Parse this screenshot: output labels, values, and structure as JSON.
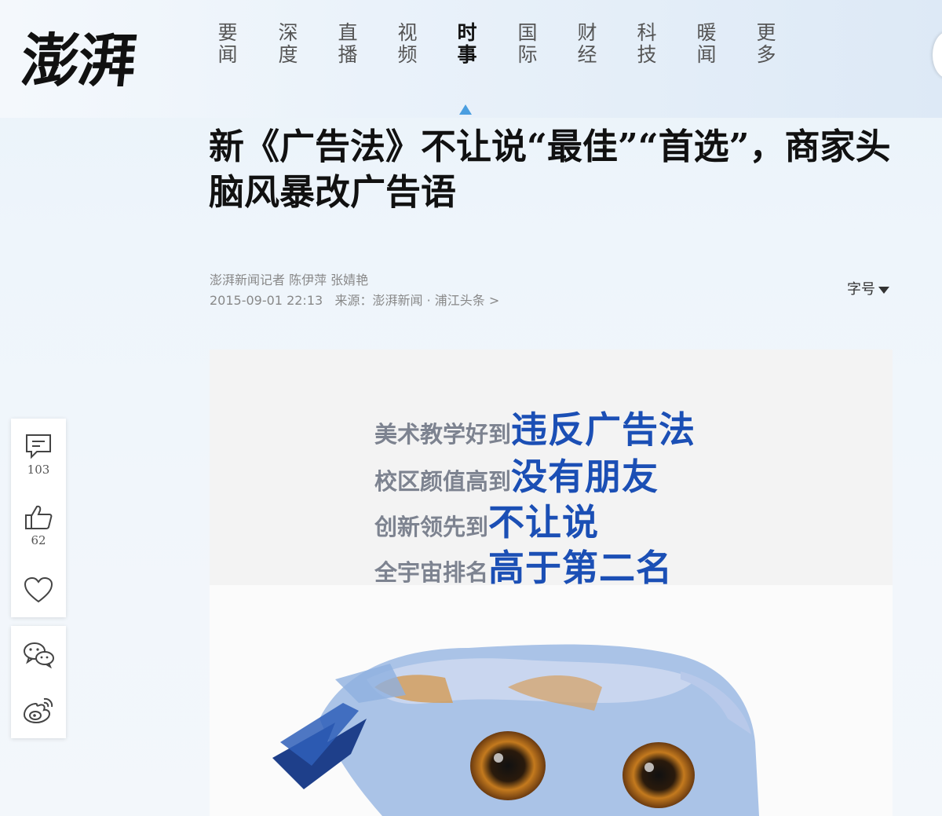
{
  "brand": {
    "logo_text": "澎湃"
  },
  "nav": {
    "items": [
      {
        "label": "要闻",
        "active": false
      },
      {
        "label": "深度",
        "active": false
      },
      {
        "label": "直播",
        "active": false
      },
      {
        "label": "视频",
        "active": false
      },
      {
        "label": "时事",
        "active": true
      },
      {
        "label": "国际",
        "active": false
      },
      {
        "label": "财经",
        "active": false
      },
      {
        "label": "科技",
        "active": false
      },
      {
        "label": "暖闻",
        "active": false
      },
      {
        "label": "更多",
        "active": false
      }
    ]
  },
  "article": {
    "title": "新《广告法》不让说“最佳”“首选”，商家头脑风暴改广告语",
    "byline": "澎湃新闻记者 陈伊萍 张婧艳",
    "timestamp": "2015-09-01 22:13",
    "source_label": "来源：",
    "source_name": "澎湃新闻",
    "separator": "·",
    "channel": "浦江头条 >",
    "font_size_label": "字号"
  },
  "sidebar": {
    "comment_count": "103",
    "like_count": "62",
    "icons": [
      "comment-icon",
      "thumbs-up-icon",
      "heart-icon",
      "wechat-icon",
      "weibo-icon"
    ]
  },
  "hero_image": {
    "lines": [
      {
        "lead": "美术教学好到",
        "em": "违反广告法"
      },
      {
        "lead": "校区颜值高到",
        "em": "没有朋友"
      },
      {
        "lead": "创新领先到",
        "em": "不让说"
      },
      {
        "lead": "全宇宙排名",
        "em": "高于第二名"
      }
    ],
    "colors": {
      "lead": "#7d8390",
      "emphasis": "#1b4fb5"
    }
  },
  "colors": {
    "nav_active_marker": "#4a9ee0",
    "meta_text": "#888888"
  }
}
